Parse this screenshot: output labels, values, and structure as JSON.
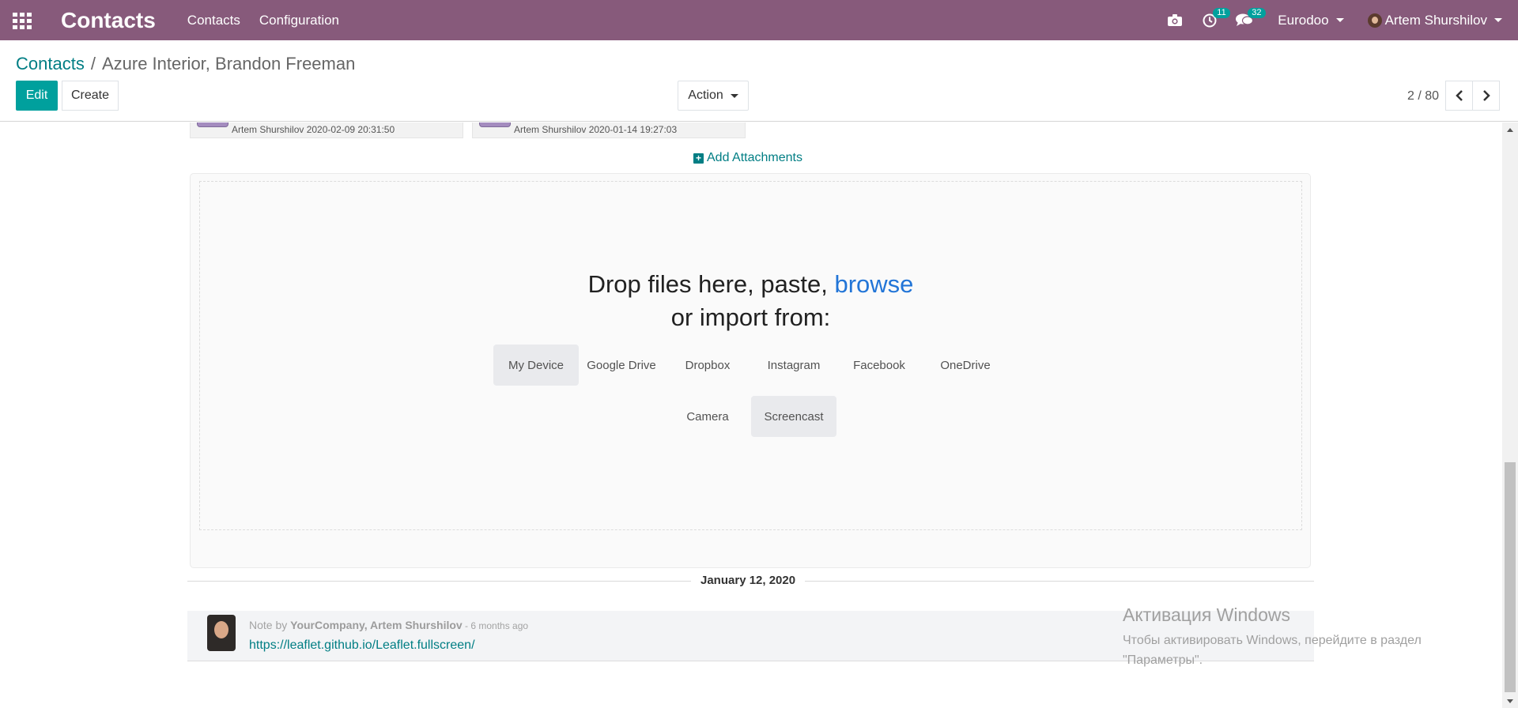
{
  "navbar": {
    "app_title": "Contacts",
    "menus": [
      "Contacts",
      "Configuration"
    ],
    "activity_count": "11",
    "messages_count": "32",
    "company": "Eurodoo",
    "user": "Artem Shurshilov"
  },
  "breadcrumb": {
    "parent": "Contacts",
    "current": "Azure Interior, Brandon Freeman"
  },
  "buttons": {
    "edit": "Edit",
    "create": "Create",
    "action": "Action"
  },
  "pager": {
    "value": "2 / 80"
  },
  "attachments": [
    {
      "meta": "Artem Shurshilov 2020-02-09 20:31:50"
    },
    {
      "meta": "Artem Shurshilov 2020-01-14 19:27:03"
    }
  ],
  "add_attachments": "Add Attachments",
  "dropzone": {
    "line1_prefix": "Drop files here, paste, ",
    "browse": "browse",
    "line2": "or import from:",
    "sources": [
      "My Device",
      "Google Drive",
      "Dropbox",
      "Instagram",
      "Facebook",
      "OneDrive",
      "Camera",
      "Screencast"
    ]
  },
  "date_separator": "January 12, 2020",
  "message": {
    "prefix": "Note by ",
    "author": "YourCompany, Artem Shurshilov",
    "time": " - 6 months ago",
    "body": "https://leaflet.github.io/Leaflet.fullscreen/"
  },
  "watermark": {
    "title": "Активация Windows",
    "line1": "Чтобы активировать Windows, перейдите в раздел",
    "line2": "\"Параметры\"."
  },
  "colors": {
    "navbar": "#875a7b",
    "accent": "#00a09d",
    "link": "#017e84",
    "browse": "#2275d7"
  }
}
